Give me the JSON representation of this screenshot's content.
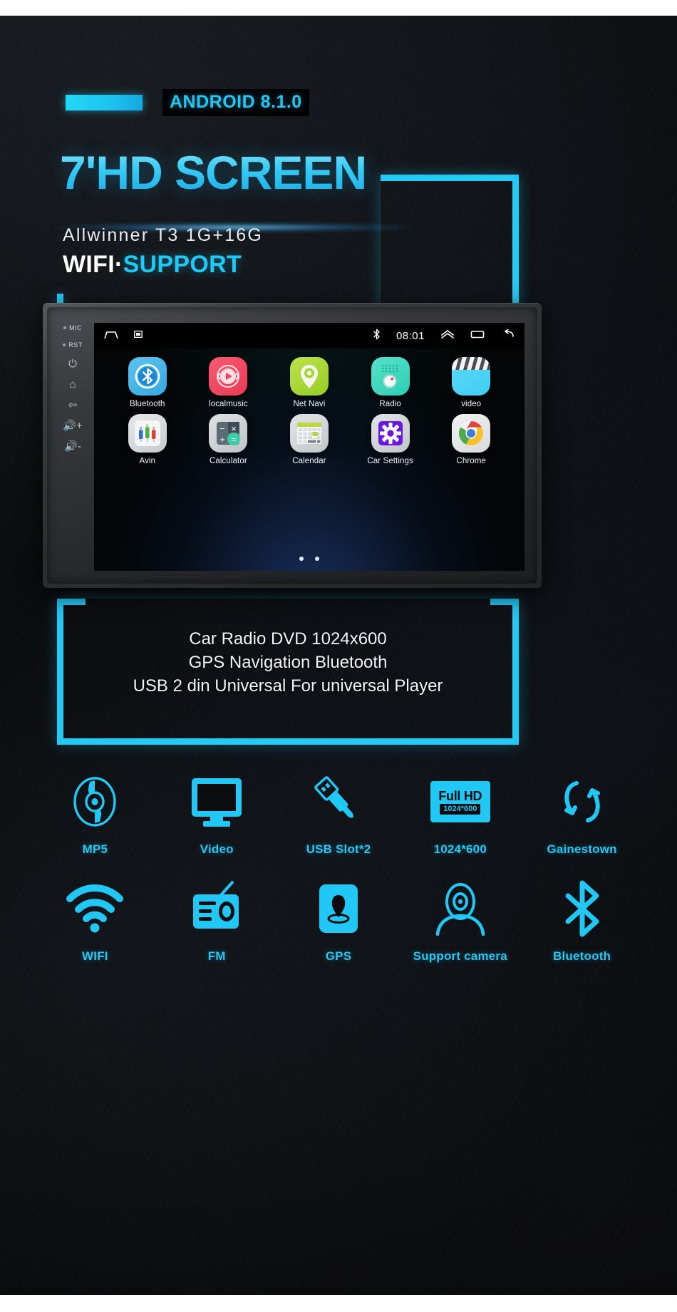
{
  "hero": {
    "android_badge": "ANDROID 8.1.0",
    "title": "7'HD SCREEN",
    "subtitle": "Allwinner T3 1G+16G",
    "wifi_white": "WIFI·",
    "wifi_cyan": "SUPPORT"
  },
  "info": {
    "line1": "Car Radio DVD 1024x600",
    "line2": "GPS Navigation Bluetooth",
    "line3": "USB 2 din Universal For universal Player"
  },
  "device": {
    "rail": {
      "mic_label": "MIC",
      "rst_label": "RST",
      "power_icon": "power-icon",
      "home_icon": "home-icon",
      "back_icon": "back-icon",
      "vol_up_icon": "volume-up-icon",
      "vol_down_icon": "volume-down-icon"
    },
    "statusbar": {
      "home_icon": "home-icon",
      "screenshot_icon": "screenshot-icon",
      "bluetooth_icon": "bluetooth-icon",
      "clock": "08:01",
      "expand_icon": "chevron-up-icon",
      "recents_icon": "recents-icon",
      "back_icon": "back-arrow-icon"
    },
    "apps": [
      {
        "label": "Bluetooth",
        "icon": "bluetooth-app-icon",
        "color": "#42b6ea"
      },
      {
        "label": "localmusic",
        "icon": "music-player-app-icon",
        "color": "#f1485e"
      },
      {
        "label": "Net Navi",
        "icon": "map-pin-app-icon",
        "color": "#a9d73a"
      },
      {
        "label": "Radio",
        "icon": "radio-app-icon",
        "color": "#3fd8c0"
      },
      {
        "label": "video",
        "icon": "clapperboard-app-icon",
        "color": "#4fd3f7"
      },
      {
        "label": "Avin",
        "icon": "rca-plugs-app-icon",
        "color": "#d8dadc"
      },
      {
        "label": "Calculator",
        "icon": "calculator-app-icon",
        "color": "#cfd2d5"
      },
      {
        "label": "Calendar",
        "icon": "calendar-app-icon",
        "color": "#d5d8da"
      },
      {
        "label": "Car Settings",
        "icon": "gear-app-icon",
        "color": "#d5d8da"
      },
      {
        "label": "Chrome",
        "icon": "chrome-app-icon",
        "color": "#e9ebec"
      }
    ],
    "pager": {
      "dots": 2,
      "active": 0
    }
  },
  "features": {
    "row1": [
      {
        "label": "MP5",
        "icon": "disc-icon"
      },
      {
        "label": "Video",
        "icon": "monitor-icon"
      },
      {
        "label": "USB Slot*2",
        "icon": "usb-plug-icon"
      },
      {
        "label": "1024*600",
        "icon": "full-hd-icon",
        "badge_top": "Full HD",
        "badge_bottom": "1024*600"
      },
      {
        "label": "Gainestown",
        "icon": "refresh-loop-icon"
      }
    ],
    "row2": [
      {
        "label": "WIFI",
        "icon": "wifi-icon"
      },
      {
        "label": "FM",
        "icon": "fm-radio-icon"
      },
      {
        "label": "GPS",
        "icon": "gps-pin-icon"
      },
      {
        "label": "Support camera",
        "icon": "camera-person-icon"
      },
      {
        "label": "Bluetooth",
        "icon": "bluetooth-icon"
      }
    ]
  },
  "colors": {
    "accent": "#22c8f5",
    "background": "#070707",
    "text_light": "#ffffff"
  }
}
